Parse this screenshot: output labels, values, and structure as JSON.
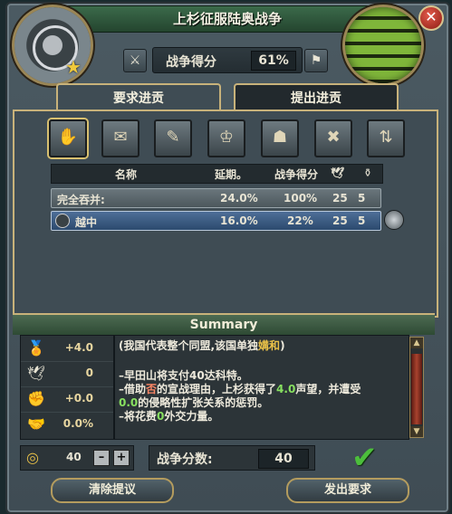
{
  "window": {
    "title": "上杉征服陆奥战争",
    "close_label": "✕"
  },
  "war": {
    "score_label": "战争得分",
    "score_value": "61%"
  },
  "tabs": [
    {
      "label": "要求进贡",
      "active": true
    },
    {
      "label": "提出进贡",
      "active": false
    }
  ],
  "toolbar": {
    "icons": [
      "demand-provinces-icon",
      "release-nation-icon",
      "annul-treaties-icon",
      "revoke-claims-icon",
      "humiliate-icon",
      "break-alliance-icon",
      "transfer-trade-icon"
    ]
  },
  "table": {
    "headers": [
      "名称",
      "延期。",
      "战争得分",
      "🕊",
      "⚱"
    ],
    "rows": [
      {
        "name": "完全吞并:",
        "delay": "24.0%",
        "warscore": "100%",
        "prestige": "25",
        "ae": "5",
        "selected": false
      },
      {
        "name": "越中",
        "delay": "16.0%",
        "warscore": "22%",
        "prestige": "25",
        "ae": "5",
        "selected": true
      }
    ]
  },
  "summary": {
    "title": "Summary",
    "effects": [
      {
        "icon": "prestige-icon",
        "value": "+4.0"
      },
      {
        "icon": "dove-icon",
        "value": "0"
      },
      {
        "icon": "aggressive-expansion-icon",
        "value": "+0.0"
      },
      {
        "icon": "diplomatic-power-icon",
        "value": "0.0%"
      }
    ],
    "desc": {
      "line1_pre": "(我国代表整个同盟,该国单独",
      "line1_hl": "媾和",
      "line1_post": ")",
      "line2": "–早田山将支付40达科特。",
      "line3_pre": "–借助",
      "line3_hl1": "否",
      "line3_mid": "的宣战理由，上杉获得了",
      "line3_hl2": "4.0",
      "line3_post": "声望，并遭受",
      "line4_hl": "0.0",
      "line4_post": "的侵略性扩张关系的惩罚。",
      "line5_pre": "–将花费",
      "line5_hl": "0",
      "line5_post": "外交力量。"
    }
  },
  "gold": {
    "value": "40",
    "minus": "–",
    "plus": "+"
  },
  "warscore": {
    "label": "战争分数:",
    "value": "40"
  },
  "buttons": {
    "clear": "清除提议",
    "send": "发出要求"
  }
}
